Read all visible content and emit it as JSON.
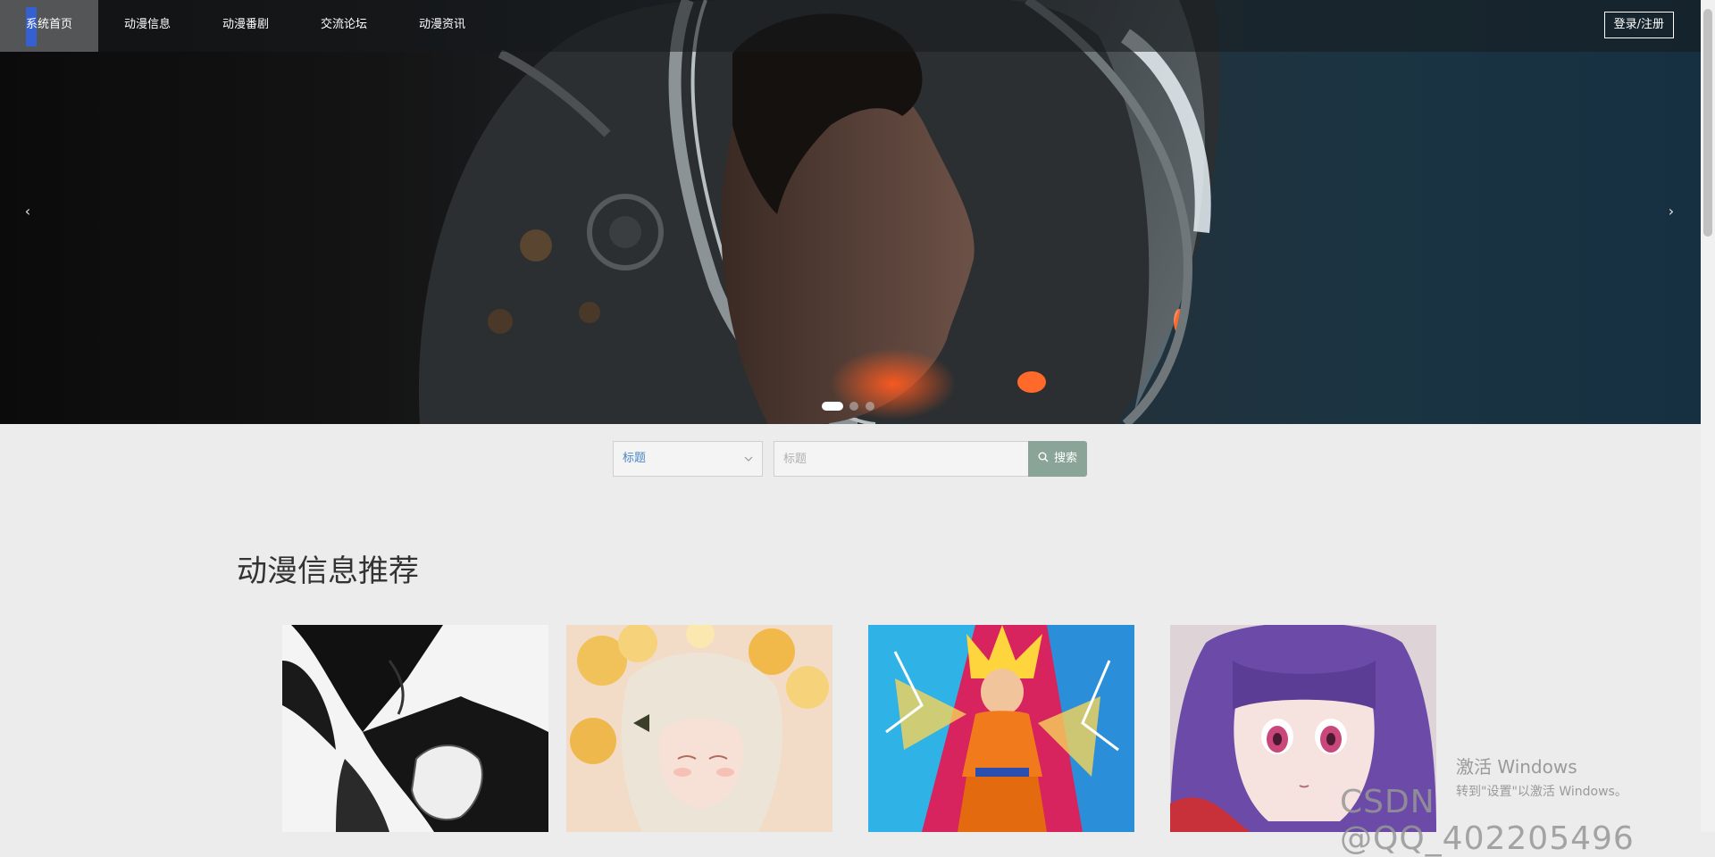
{
  "nav": {
    "items": [
      {
        "label": "系统首页",
        "active": true
      },
      {
        "label": "动漫信息",
        "active": false
      },
      {
        "label": "动漫番剧",
        "active": false
      },
      {
        "label": "交流论坛",
        "active": false
      },
      {
        "label": "动漫资讯",
        "active": false
      }
    ],
    "login_label": "登录/注册"
  },
  "carousel": {
    "prev_icon": "chevron-left-icon",
    "next_icon": "chevron-right-icon",
    "prev_glyph": "‹",
    "next_glyph": "›",
    "slide_count": 3,
    "active_index": 0
  },
  "search": {
    "field_select_value": "标题",
    "input_placeholder": "标题",
    "input_value": "",
    "button_label": "搜索",
    "button_color": "#8aa598"
  },
  "section": {
    "title": "动漫信息推荐",
    "cards": [
      {
        "image": "monochrome-anime-couple-image"
      },
      {
        "image": "floral-anime-girl-image"
      },
      {
        "image": "super-saiyan-anime-image"
      },
      {
        "image": "purple-hair-anime-girl-image"
      }
    ]
  },
  "overlay": {
    "windows_activate_title": "激活 Windows",
    "windows_activate_hint": "转到\"设置\"以激活 Windows。",
    "watermark": "CSDN @QQ_402205496"
  },
  "colors": {
    "nav_active_bar": "#2f63e8",
    "select_text": "#4a86c7",
    "page_background": "#ececec"
  }
}
